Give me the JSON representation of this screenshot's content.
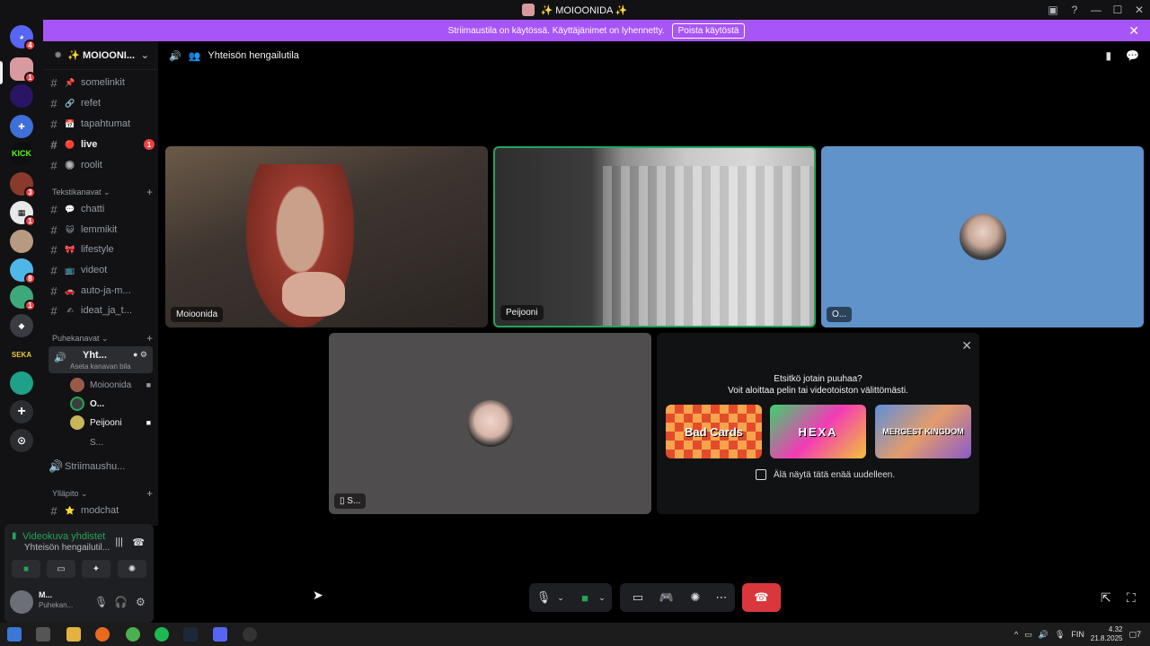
{
  "window": {
    "title": "✨ MOIOONIDA ✨",
    "controls": [
      "—",
      "☐",
      "✕"
    ]
  },
  "banner": {
    "text": "Striimaustila on käytössä. Käyttäjänimet on lyhennetty.",
    "button": "Poista käytöstä"
  },
  "rail": {
    "badges": [
      "4",
      "1",
      "3",
      "1",
      "8",
      "1"
    ]
  },
  "server": {
    "name": "✨ MOIOONI..."
  },
  "channels": [
    {
      "emoji": "📌",
      "label": "somelinkit"
    },
    {
      "emoji": "🔗",
      "label": "refet"
    },
    {
      "emoji": "📅",
      "label": "tapahtumat"
    },
    {
      "emoji": "🔴",
      "label": "live",
      "badge": "1"
    },
    {
      "emoji": "🔘",
      "label": "roolit"
    }
  ],
  "categories": {
    "text": "Tekstikanavat",
    "voice": "Puhekanavat",
    "admin": "Ylläpito"
  },
  "text_channels": [
    {
      "emoji": "💬",
      "label": "chatti"
    },
    {
      "emoji": "😺",
      "label": "lemmikit"
    },
    {
      "emoji": "🎀",
      "label": "lifestyle"
    },
    {
      "emoji": "📺",
      "label": "videot"
    },
    {
      "emoji": "🚗",
      "label": "auto-ja-m..."
    },
    {
      "emoji": "✍",
      "label": "ideat_ja_t..."
    }
  ],
  "voice_channel": {
    "name": "Yht...",
    "hint": "Aseta kanavan bila"
  },
  "voice_users": [
    {
      "name": "Moioonida"
    },
    {
      "name": "O..."
    },
    {
      "name": "Peijooni"
    },
    {
      "name": "S..."
    }
  ],
  "other_voice": "Striimaushu...",
  "admin_channels": [
    {
      "emoji": "⭐",
      "label": "modchat"
    }
  ],
  "voice_panel": {
    "status": "Videokuva yhdistet",
    "channel": "Yhteisön hengailutil..."
  },
  "user": {
    "name": "M...",
    "status": "Puhekan..."
  },
  "main": {
    "channel_title": "Yhteisön hengailutila"
  },
  "tiles": [
    {
      "label": "Moioonida"
    },
    {
      "label": "Peijooni"
    },
    {
      "label": "O..."
    },
    {
      "label": "S..."
    }
  ],
  "activity": {
    "heading": "Etsitkö jotain puuhaa?",
    "subheading": "Voit aloittaa pelin tai videotoiston välittömästi.",
    "games": [
      "Bad Cards",
      "HEXA",
      "MERGEST KINGDOM"
    ],
    "checkbox": "Älä näytä tätä enää uudelleen."
  },
  "taskbar": {
    "lang": "FIN",
    "time": "4.32",
    "date": "21.8.2025",
    "notif": "7"
  }
}
